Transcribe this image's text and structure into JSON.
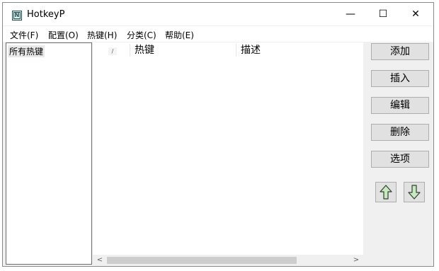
{
  "window": {
    "title": "HotkeyP",
    "app_icon_letter": "N",
    "controls": {
      "minimize": "—",
      "maximize": "☐",
      "close": "✕"
    }
  },
  "menu": [
    "文件(F)",
    "配置(O)",
    "热键(H)",
    "分类(C)",
    "帮助(E)"
  ],
  "categories": {
    "items": [
      "所有热键"
    ]
  },
  "list": {
    "check_header": "/",
    "columns": [
      "热键",
      "描述"
    ],
    "scroll_left": "<",
    "scroll_right": ">"
  },
  "actions": [
    "添加",
    "插入",
    "编辑",
    "删除",
    "选项"
  ],
  "move_buttons": {
    "up": "up-arrow-icon",
    "down": "down-arrow-icon"
  },
  "colors": {
    "arrow_fill": "#c8e8c0",
    "arrow_stroke": "#304030"
  }
}
